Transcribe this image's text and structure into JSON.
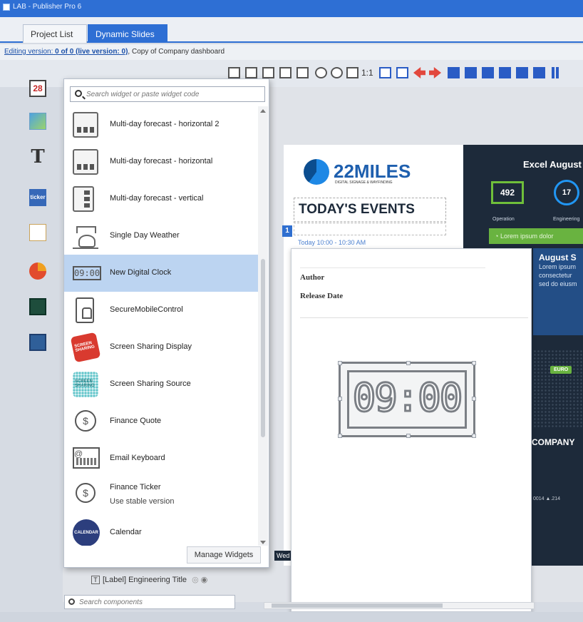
{
  "window": {
    "title": "LAB - Publisher Pro 6"
  },
  "tabs": [
    {
      "label": "Project List"
    },
    {
      "label": "Dynamic Slides"
    }
  ],
  "editing_bar": {
    "prefix": "Editing version:",
    "version": "0 of 0",
    "live": "(live version: 0)",
    "suffix": ", Copy of Company dashboard"
  },
  "toolbar": {
    "zoom_label": "1:1"
  },
  "palette": {
    "calendar_day": "28",
    "ticker_label": "ticker"
  },
  "widget_picker": {
    "search_placeholder": "Search widget or paste widget code",
    "items": [
      {
        "label": "Multi-day forecast - horizontal 2"
      },
      {
        "label": "Multi-day forecast - horizontal"
      },
      {
        "label": "Multi-day forecast - vertical"
      },
      {
        "label": "Single Day Weather"
      },
      {
        "label": "New Digital Clock",
        "icon_text": "09:00",
        "selected": true
      },
      {
        "label": "SecureMobileControl"
      },
      {
        "label": "Screen Sharing Display",
        "icon_text": "SCREEN SHARING"
      },
      {
        "label": "Screen Sharing Source",
        "icon_text": "SCREEN SHARING"
      },
      {
        "label": "Finance Quote"
      },
      {
        "label": "Email Keyboard"
      },
      {
        "label": "Finance Ticker",
        "sub": "Use stable version"
      },
      {
        "label": "Calendar",
        "icon_text": "CALENDAR"
      }
    ],
    "manage_label": "Manage Widgets"
  },
  "slide": {
    "logo_text": "22MILES",
    "logo_tag": "DIGITAL SIGNAGE & WAYFINDING",
    "events_title": "TODAY'S EVENTS",
    "events_badge": "1",
    "events_time": "Today 10:00 - 10:30 AM",
    "right_title": "Excel August",
    "stat_operation": "492",
    "stat_engineering": "17",
    "stat_operation_label": "Operation",
    "stat_engineering_label": "Engineering",
    "green_text": "Lorem ipsum dolor",
    "aug_title": "August S",
    "aug_text": [
      "Lorem ipsum",
      "consectetur",
      "sed do eiusm"
    ],
    "euro": "EURO",
    "company": "COMPANY",
    "ticker": "0014 ▲.214",
    "wed": "Wed"
  },
  "detail_panel": {
    "author_label": "Author",
    "release_label": "Release Date",
    "clock_preview": "09:00"
  },
  "components": {
    "row_label": "[Label] Engineering Title",
    "search_placeholder": "Search components"
  },
  "colors": {
    "accent": "#2e6fd4",
    "selection": "#bcd4f1",
    "slide_dark": "#1d2a3a",
    "green": "#69b340"
  }
}
